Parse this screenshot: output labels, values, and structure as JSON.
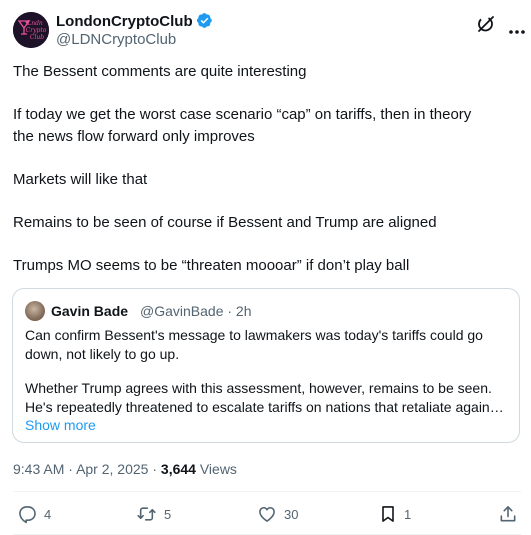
{
  "author": {
    "name": "LondonCryptoClub",
    "handle": "@LDNCryptoClub",
    "verified": true,
    "avatar_text": "London Crypto Club"
  },
  "tweet": {
    "lines": [
      "The Bessent comments are quite interesting",
      "If today we get the worst case scenario “cap” on tariffs, then in theory",
      "the news flow forward only improves",
      "Markets will like that",
      "Remains to be seen of course if Bessent and Trump are aligned",
      "Trumps MO seems to be “threaten moooar” if don’t play ball"
    ]
  },
  "quote": {
    "name": "Gavin Bade",
    "meta": "@GavinBade · 2h",
    "lines": [
      "Can confirm Bessent's message to lawmakers was today's tariffs could go",
      "down, not likely to go up.",
      "Whether Trump agrees with this assessment, however, remains to be seen.",
      "He's repeatedly threatened to escalate tariffs on nations that retaliate against the U.S."
    ],
    "show_more": "Show more"
  },
  "meta": {
    "time": "9:43 AM",
    "separator": "·",
    "date": "Apr 2, 2025",
    "views_count": "3,644",
    "views_label": "Views"
  },
  "actions": {
    "replies": "4",
    "reposts": "5",
    "likes": "30",
    "bookmarks": "1"
  },
  "colors": {
    "text": "#0f1419",
    "secondary": "#536471",
    "link": "#1d9bf0",
    "verified": "#1d9bf0",
    "border": "#cfd9de"
  },
  "icons": [
    "grok-icon",
    "more-icon",
    "verified-badge-icon",
    "reply-icon",
    "repost-icon",
    "like-icon",
    "bookmark-icon",
    "share-icon"
  ]
}
